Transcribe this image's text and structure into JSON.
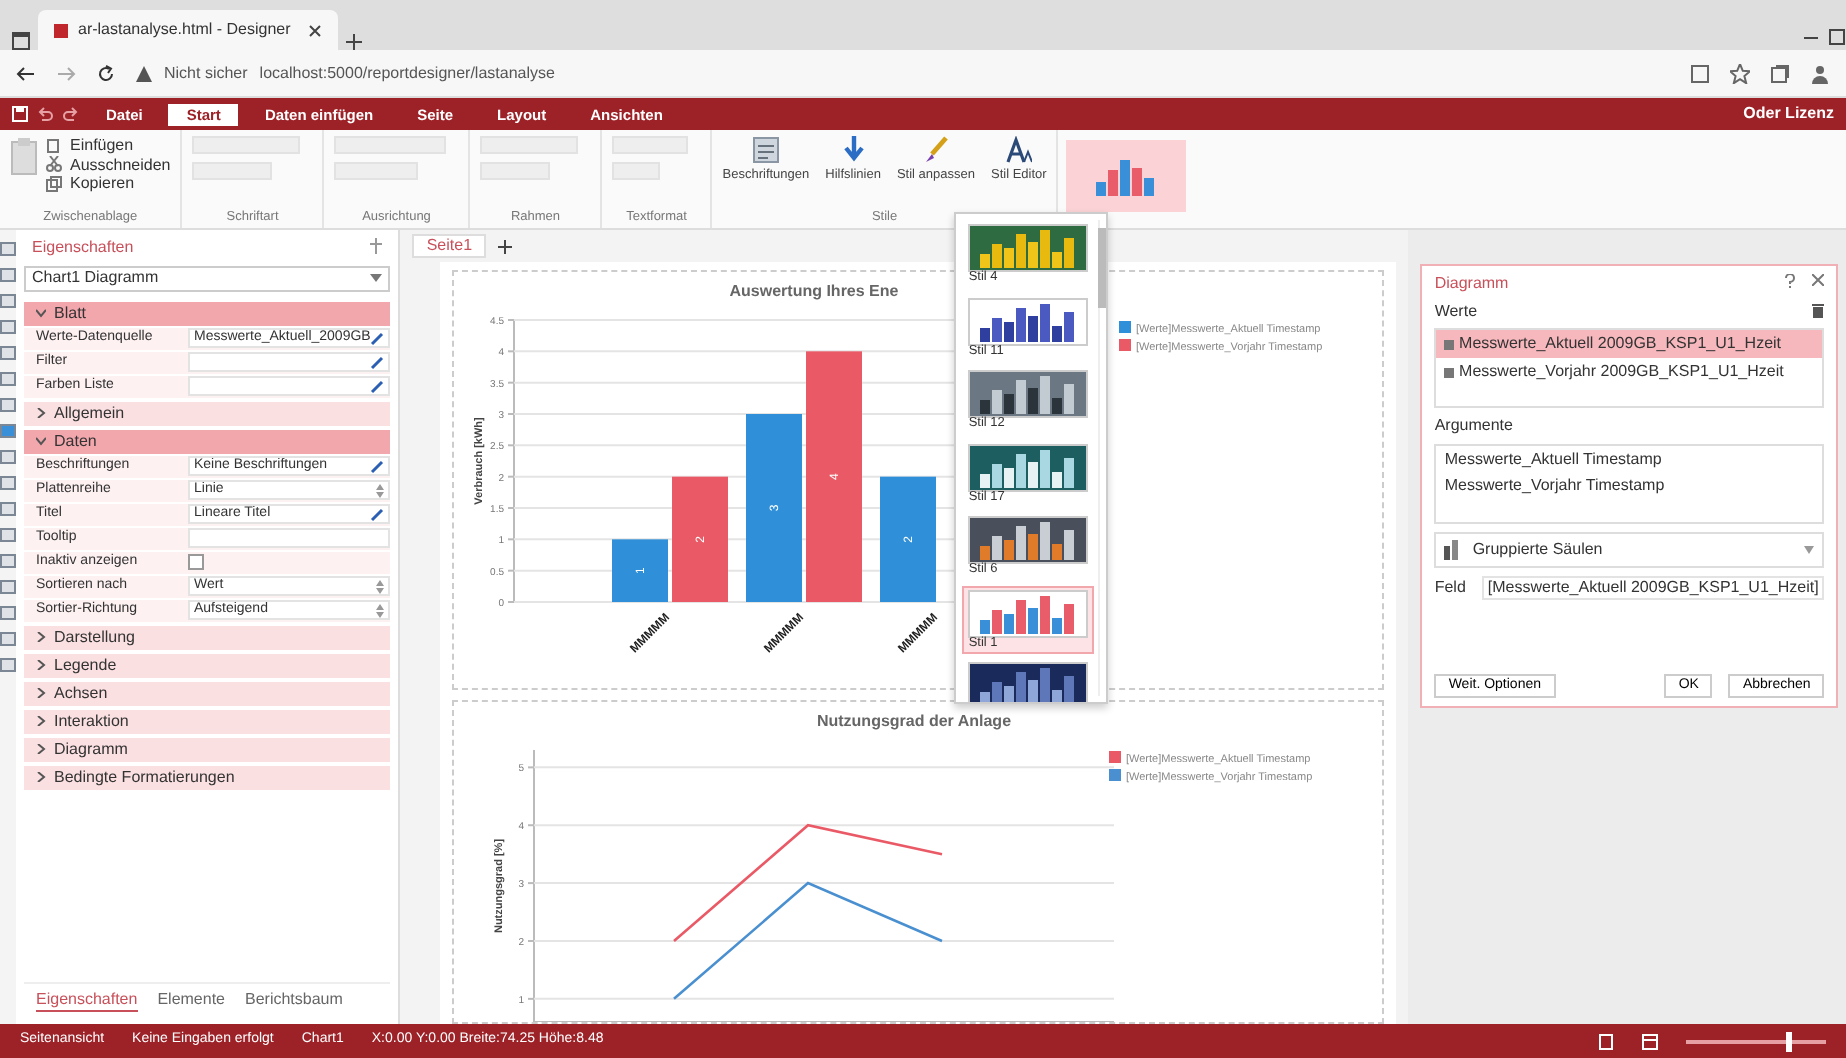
{
  "browser": {
    "tab_title": "ar-lastanalyse.html - Designer",
    "security": "Nicht sicher",
    "url": "localhost:5000/reportdesigner/lastanalyse"
  },
  "app": {
    "menu": [
      {
        "label": "Datei",
        "selected": false
      },
      {
        "label": "Start",
        "selected": true
      },
      {
        "label": "Daten einfügen",
        "selected": false
      },
      {
        "label": "Seite",
        "selected": false
      },
      {
        "label": "Layout",
        "selected": false
      },
      {
        "label": "Ansichten",
        "selected": false
      }
    ],
    "account": "Oder Lizenz"
  },
  "ribbon": {
    "clipboard": {
      "label": "Zwischenablage",
      "items": [
        "Einfügen",
        "Ausschneiden",
        "Kopieren"
      ]
    },
    "format_groups": [
      "Schriftart",
      "Ausrichtung",
      "Rahmen",
      "Textformat"
    ],
    "styles": {
      "label": "Stile",
      "items": [
        {
          "label": "Beschriftungen",
          "kind": "labels"
        },
        {
          "label": "Hilfslinien",
          "kind": "arrow"
        },
        {
          "label": "Stil anpassen",
          "kind": "brush"
        },
        {
          "label": "Stil Editor",
          "kind": "font"
        }
      ]
    },
    "style_button": {
      "selected": true
    }
  },
  "style_gallery": {
    "items": [
      {
        "label": "Stil 4",
        "selected": false
      },
      {
        "label": "Stil 11",
        "selected": false
      },
      {
        "label": "Stil 12",
        "selected": false
      },
      {
        "label": "Stil 17",
        "selected": false
      },
      {
        "label": "Stil 6",
        "selected": false
      },
      {
        "label": "Stil 1",
        "selected": true
      }
    ]
  },
  "properties": {
    "title": "Eigenschaften",
    "object": "Chart1 Diagramm",
    "sections": [
      {
        "label": "Blatt",
        "expanded": true,
        "rows": [
          {
            "label": "Werte-Datenquelle",
            "kind": "edit",
            "value": "Messwerte_Aktuell_2009GB"
          },
          {
            "label": "Filter",
            "kind": "edit"
          },
          {
            "label": "Farben Liste",
            "kind": "edit"
          }
        ]
      },
      {
        "label": "Allgemein",
        "expanded": false
      },
      {
        "label": "Daten",
        "expanded": true,
        "rows": [
          {
            "label": "Beschriftungen",
            "kind": "edit",
            "value": "Keine Beschriftungen"
          },
          {
            "label": "Plattenreihe",
            "kind": "select",
            "value": "Linie"
          },
          {
            "label": "Titel",
            "kind": "edit",
            "value": "Lineare Titel"
          },
          {
            "label": "Tooltip",
            "kind": "text"
          },
          {
            "label": "Inaktiv anzeigen",
            "kind": "check",
            "checked": false
          },
          {
            "label": "Sortieren nach",
            "kind": "select",
            "value": "Wert"
          },
          {
            "label": "Sortier-Richtung",
            "kind": "select",
            "value": "Aufsteigend"
          }
        ]
      },
      {
        "label": "Darstellung",
        "expanded": false
      },
      {
        "label": "Legende",
        "expanded": false
      },
      {
        "label": "Achsen",
        "expanded": false
      },
      {
        "label": "Interaktion",
        "expanded": false
      },
      {
        "label": "Diagramm",
        "expanded": false
      },
      {
        "label": "Bedingte Formatierungen",
        "expanded": false
      }
    ],
    "bottom_tabs": [
      {
        "label": "Eigenschaften",
        "selected": true
      },
      {
        "label": "Elemente",
        "selected": false
      },
      {
        "label": "Berichtsbaum",
        "selected": false
      }
    ]
  },
  "document": {
    "page_tab": "Seite1",
    "charts": [
      {
        "chart_data": {
          "type": "bar",
          "title": "Auswertung Ihres Ene",
          "ylabel": "Verbrauch [kWh]",
          "categories": [
            "MMMMM",
            "MMMMM",
            "MMMMM"
          ],
          "series": [
            {
              "name": "[Werte]Messwerte_Aktuell Timestamp",
              "color": "#2f8fd8",
              "values": [
                1,
                3,
                2
              ]
            },
            {
              "name": "[Werte]Messwerte_Vorjahr Timestamp",
              "color": "#ea5a66",
              "values": [
                2,
                4,
                null
              ]
            }
          ],
          "ylim": [
            0,
            4.5
          ],
          "yticks": [
            0,
            0.5,
            1,
            1.5,
            2,
            2.5,
            3,
            3.5,
            4,
            4.5
          ],
          "grid": true,
          "legend": "right",
          "value_labels": [
            [
              "1",
              "3",
              "2"
            ],
            [
              "2",
              "4",
              null
            ]
          ]
        }
      },
      {
        "chart_data": {
          "type": "line",
          "title": "Nutzungsgrad der Anlage",
          "ylabel": "Nutzungsgrad [%]",
          "series": [
            {
              "name": "[Werte]Messwerte_Aktuell Timestamp",
              "color": "#ea5a66",
              "values": [
                2,
                4,
                3.5
              ]
            },
            {
              "name": "[Werte]Messwerte_Vorjahr Timestamp",
              "color": "#4a90d0",
              "values": [
                1,
                3,
                2
              ]
            }
          ],
          "ylim": [
            0.6,
            5.3
          ],
          "yticks": [
            1,
            2,
            3,
            4,
            5
          ],
          "grid": true,
          "legend": "right"
        }
      }
    ]
  },
  "dialog": {
    "title": "Diagramm",
    "values_label": "Werte",
    "values": [
      {
        "label": "Messwerte_Aktuell 2009GB_KSP1_U1_Hzeit",
        "selected": true
      },
      {
        "label": "Messwerte_Vorjahr 2009GB_KSP1_U1_Hzeit",
        "selected": false
      }
    ],
    "arguments_label": "Argumente",
    "arguments": [
      "Messwerte_Aktuell Timestamp",
      "Messwerte_Vorjahr Timestamp"
    ],
    "chart_type": "Gruppierte Säulen",
    "field_label": "Feld",
    "field_value": "[Messwerte_Aktuell 2009GB_KSP1_U1_Hzeit]",
    "buttons": [
      "Weit. Optionen",
      "OK",
      "Abbrechen"
    ]
  },
  "status_bar": {
    "items": [
      "Seitenansicht",
      "Keine Eingaben erfolgt",
      "Chart1",
      "X:0.00 Y:0.00 Breite:74.25 Höhe:8.48"
    ],
    "zoom_slider": {
      "level": 0.72
    }
  }
}
